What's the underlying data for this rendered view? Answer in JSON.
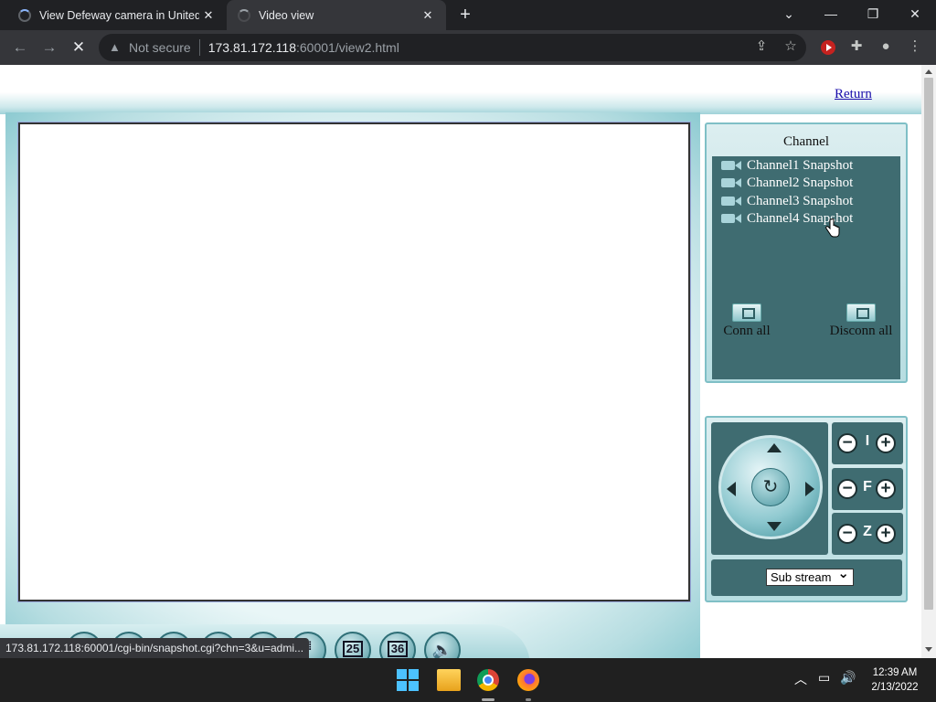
{
  "browser": {
    "tabs": [
      {
        "title": "View Defeway camera in United S"
      },
      {
        "title": "Video view"
      }
    ],
    "address": {
      "security_label": "Not secure",
      "host": "173.81.172.118",
      "path": ":60001/view2.html"
    },
    "window_controls": {
      "minimize": "—",
      "restore": "❐",
      "close": "✕",
      "tab_search": "⌄"
    }
  },
  "page": {
    "return_link": "Return",
    "channel_panel": {
      "title": "Channel",
      "items": [
        {
          "label": "Channel1 Snapshot"
        },
        {
          "label": "Channel2 Snapshot"
        },
        {
          "label": "Channel3 Snapshot"
        },
        {
          "label": "Channel4 Snapshot"
        }
      ],
      "conn_all": "Conn all",
      "disconn_all": "Disconn all"
    },
    "ptz": {
      "iris_label": "I",
      "focus_label": "F",
      "zoom_label": "Z",
      "stream_select": "Sub stream"
    },
    "bottom_tools": {
      "btn_25": "25",
      "btn_36": "36"
    }
  },
  "status_url": "173.81.172.118:60001/cgi-bin/snapshot.cgi?chn=3&u=admi...",
  "taskbar": {
    "time": "12:39 AM",
    "date": "2/13/2022"
  }
}
